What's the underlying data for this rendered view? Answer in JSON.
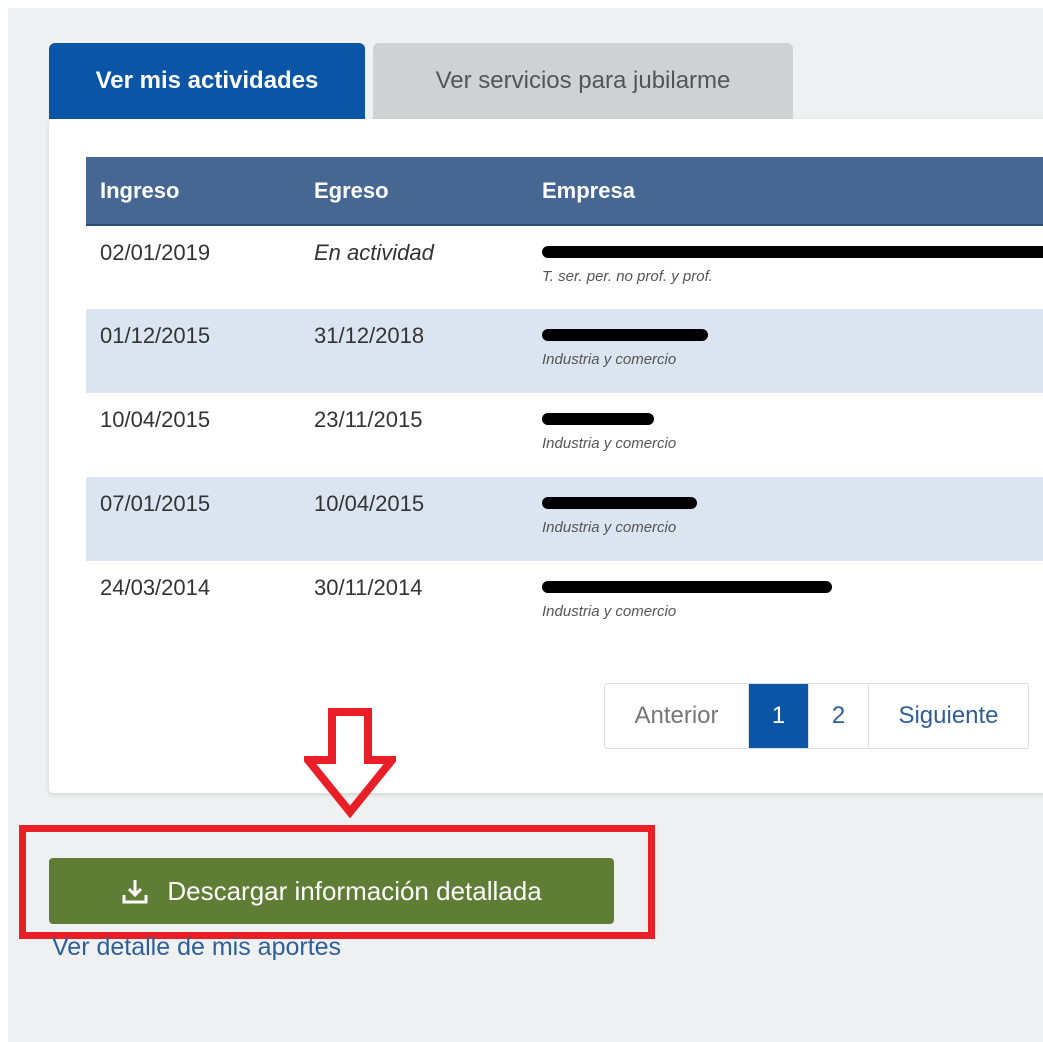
{
  "tabs": {
    "active": "Ver mis actividades",
    "inactive": "Ver servicios para jubilarme"
  },
  "table": {
    "headers": {
      "ingreso": "Ingreso",
      "egreso": "Egreso",
      "empresa": "Empresa"
    },
    "rows": [
      {
        "ingreso": "02/01/2019",
        "egreso": "En actividad",
        "empresa_sub": "T. ser. per. no prof. y prof.",
        "redacted": true
      },
      {
        "ingreso": "01/12/2015",
        "egreso": "31/12/2018",
        "empresa_sub": "Industria y comercio",
        "redacted": true
      },
      {
        "ingreso": "10/04/2015",
        "egreso": "23/11/2015",
        "empresa_sub": "Industria y comercio",
        "redacted": true
      },
      {
        "ingreso": "07/01/2015",
        "egreso": "10/04/2015",
        "empresa_sub": "Industria y comercio",
        "redacted": true
      },
      {
        "ingreso": "24/03/2014",
        "egreso": "30/11/2014",
        "empresa_sub": "Industria y comercio",
        "redacted": true
      }
    ]
  },
  "pagination": {
    "prev": "Anterior",
    "pages": [
      "1",
      "2"
    ],
    "current": "1",
    "next": "Siguiente"
  },
  "download_button": {
    "label": "Descargar información detallada",
    "icon": "download-icon"
  },
  "detail_link": "Ver detalle de mis aportes",
  "annotations": {
    "arrow_icon": "down-arrow-icon",
    "arrow_color": "#e81f26",
    "box_color": "#e81f26"
  },
  "colors": {
    "primary": "#0a55a5",
    "table_header": "#456792",
    "row_stripe": "#dbe5f1",
    "download_button": "#5f7d35",
    "link": "#2e5f95"
  }
}
